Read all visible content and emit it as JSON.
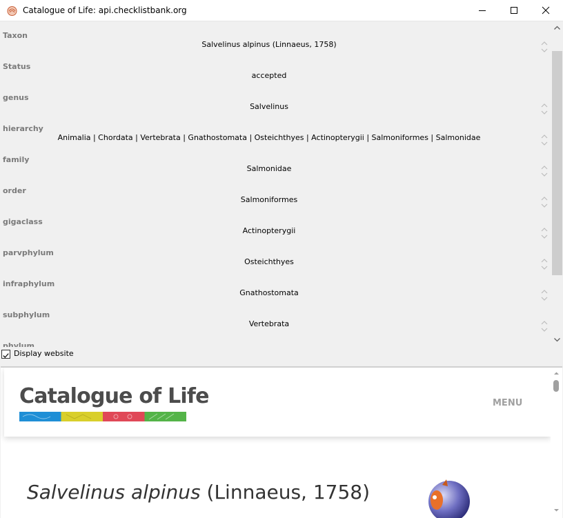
{
  "window": {
    "title": "Catalogue of Life: api.checklistbank.org"
  },
  "properties": [
    {
      "label": "Taxon",
      "value": "Salvelinus alpinus (Linnaeus, 1758)"
    },
    {
      "label": "Status",
      "value": "accepted"
    },
    {
      "label": "genus",
      "value": "Salvelinus"
    },
    {
      "label": "hierarchy",
      "value": "Animalia | Chordata | Vertebrata | Gnathostomata | Osteichthyes | Actinopterygii | Salmoniformes | Salmonidae"
    },
    {
      "label": "family",
      "value": "Salmonidae"
    },
    {
      "label": "order",
      "value": "Salmoniformes"
    },
    {
      "label": "gigaclass",
      "value": "Actinopterygii"
    },
    {
      "label": "parvphylum",
      "value": "Osteichthyes"
    },
    {
      "label": "infraphylum",
      "value": "Gnathostomata"
    },
    {
      "label": "subphylum",
      "value": "Vertebrata"
    },
    {
      "label": "phylum",
      "value": ""
    }
  ],
  "display_website": {
    "label": "Display website",
    "checked": true
  },
  "website": {
    "logo_text": "Catalogue of Life",
    "menu_label": "MENU",
    "species_name": "Salvelinus alpinus",
    "species_author": "(Linnaeus, 1758)"
  },
  "colors": {
    "logo_bar": [
      "#1f8fd6",
      "#d9cf2b",
      "#e04857",
      "#54b448"
    ]
  },
  "icons": {
    "app": "shell-icon",
    "minimize": "minimize-icon",
    "maximize": "maximize-icon",
    "close": "close-icon",
    "checkbox": "checkmark-icon",
    "globe": "globe-icon"
  }
}
